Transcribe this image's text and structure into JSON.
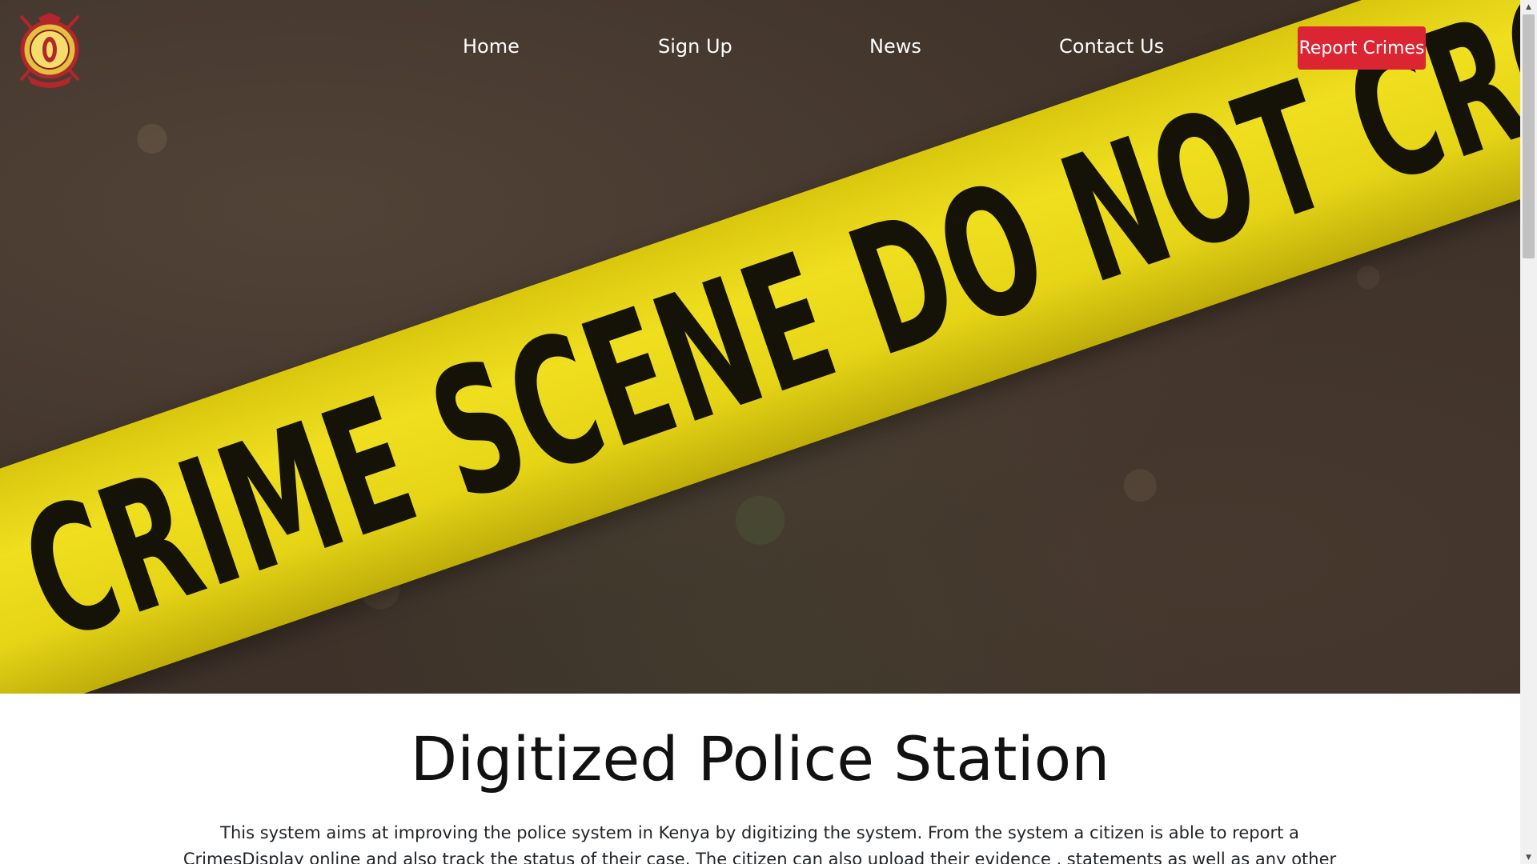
{
  "nav": {
    "logo_alt": "Kenya Police emblem",
    "links": [
      {
        "label": "Home"
      },
      {
        "label": "Sign Up"
      },
      {
        "label": "News"
      },
      {
        "label": "Contact Us"
      }
    ],
    "report_button": "Report Crimes"
  },
  "hero": {
    "tape_text": "CRIME SCENE DO NOT CROSS"
  },
  "main": {
    "title": "Digitized Police Station",
    "intro": "This system aims at improving the police system in Kenya by digitizing the system. From the system a citizen is able to report a CrimesDisplay online and also track the status of their case. The citizen can also upload their evidence , statements as well as any other necessary information into the"
  },
  "colors": {
    "accent": "#dc2533",
    "tape": "#efdf1f",
    "hero_bg": "#3d3129"
  },
  "icons": {
    "scroll_up": "scroll-up-arrow-icon",
    "scroll_down": "scroll-down-arrow-icon"
  }
}
